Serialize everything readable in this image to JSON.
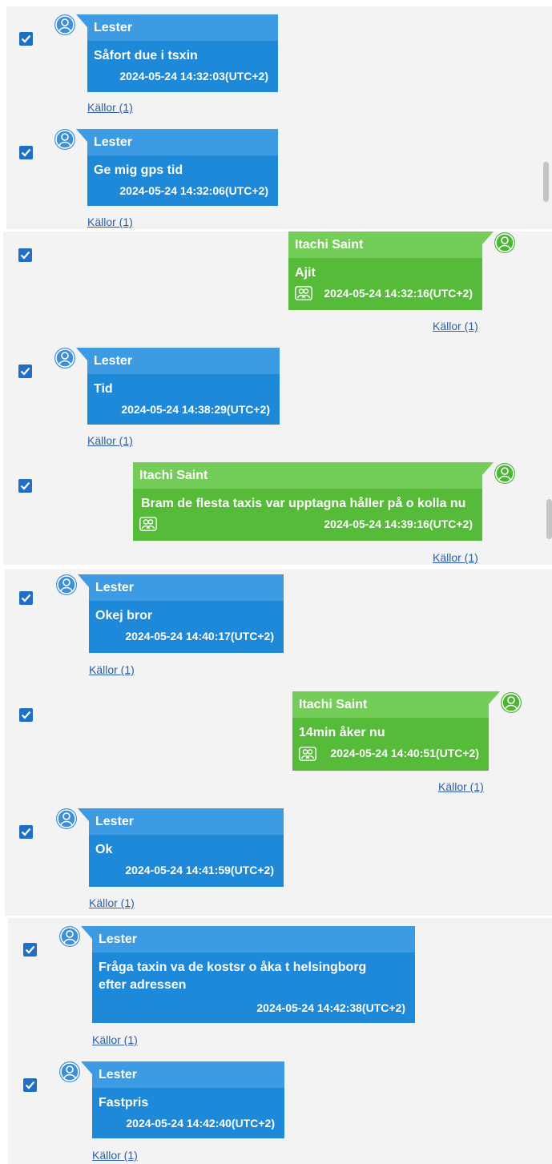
{
  "colors": {
    "blue_bubble": "#1e88d9",
    "blue_header": "#3d9be3",
    "green_bubble": "#56bb38",
    "green_header": "#74cc59",
    "checkbox": "#1f6fc7",
    "link": "#2b5fa8"
  },
  "messages": [
    {
      "sender": "Lester",
      "text": "Såfort due i tsxin",
      "time": "2024-05-24 14:32:03(UTC+2)",
      "sources": "Källor (1)",
      "side": "left"
    },
    {
      "sender": "Lester",
      "text": "Ge mig gps tid",
      "time": "2024-05-24 14:32:06(UTC+2)",
      "sources": "Källor (1)",
      "side": "left"
    },
    {
      "sender": "Itachi Saint",
      "text": "Ajit",
      "time": "2024-05-24 14:32:16(UTC+2)",
      "sources": "Källor (1)",
      "side": "right"
    },
    {
      "sender": "Lester",
      "text": "Tid",
      "time": "2024-05-24 14:38:29(UTC+2)",
      "sources": "Källor (1)",
      "side": "left"
    },
    {
      "sender": "Itachi Saint",
      "text": "Bram de flesta taxis var upptagna håller på o kolla nu",
      "time": "2024-05-24 14:39:16(UTC+2)",
      "sources": "Källor (1)",
      "side": "right"
    },
    {
      "sender": "Lester",
      "text": "Okej bror",
      "time": "2024-05-24 14:40:17(UTC+2)",
      "sources": "Källor (1)",
      "side": "left"
    },
    {
      "sender": "Itachi Saint",
      "text": "14min åker nu",
      "time": "2024-05-24 14:40:51(UTC+2)",
      "sources": "Källor (1)",
      "side": "right"
    },
    {
      "sender": "Lester",
      "text": "Ok",
      "time": "2024-05-24 14:41:59(UTC+2)",
      "sources": "Källor (1)",
      "side": "left"
    },
    {
      "sender": "Lester",
      "text": "Fråga taxin va de kostsr o åka t helsingborg efter adressen",
      "time": "2024-05-24 14:42:38(UTC+2)",
      "sources": "Källor (1)",
      "side": "left"
    },
    {
      "sender": "Lester",
      "text": "Fastpris",
      "time": "2024-05-24 14:42:40(UTC+2)",
      "sources": "Källor (1)",
      "side": "left"
    }
  ]
}
